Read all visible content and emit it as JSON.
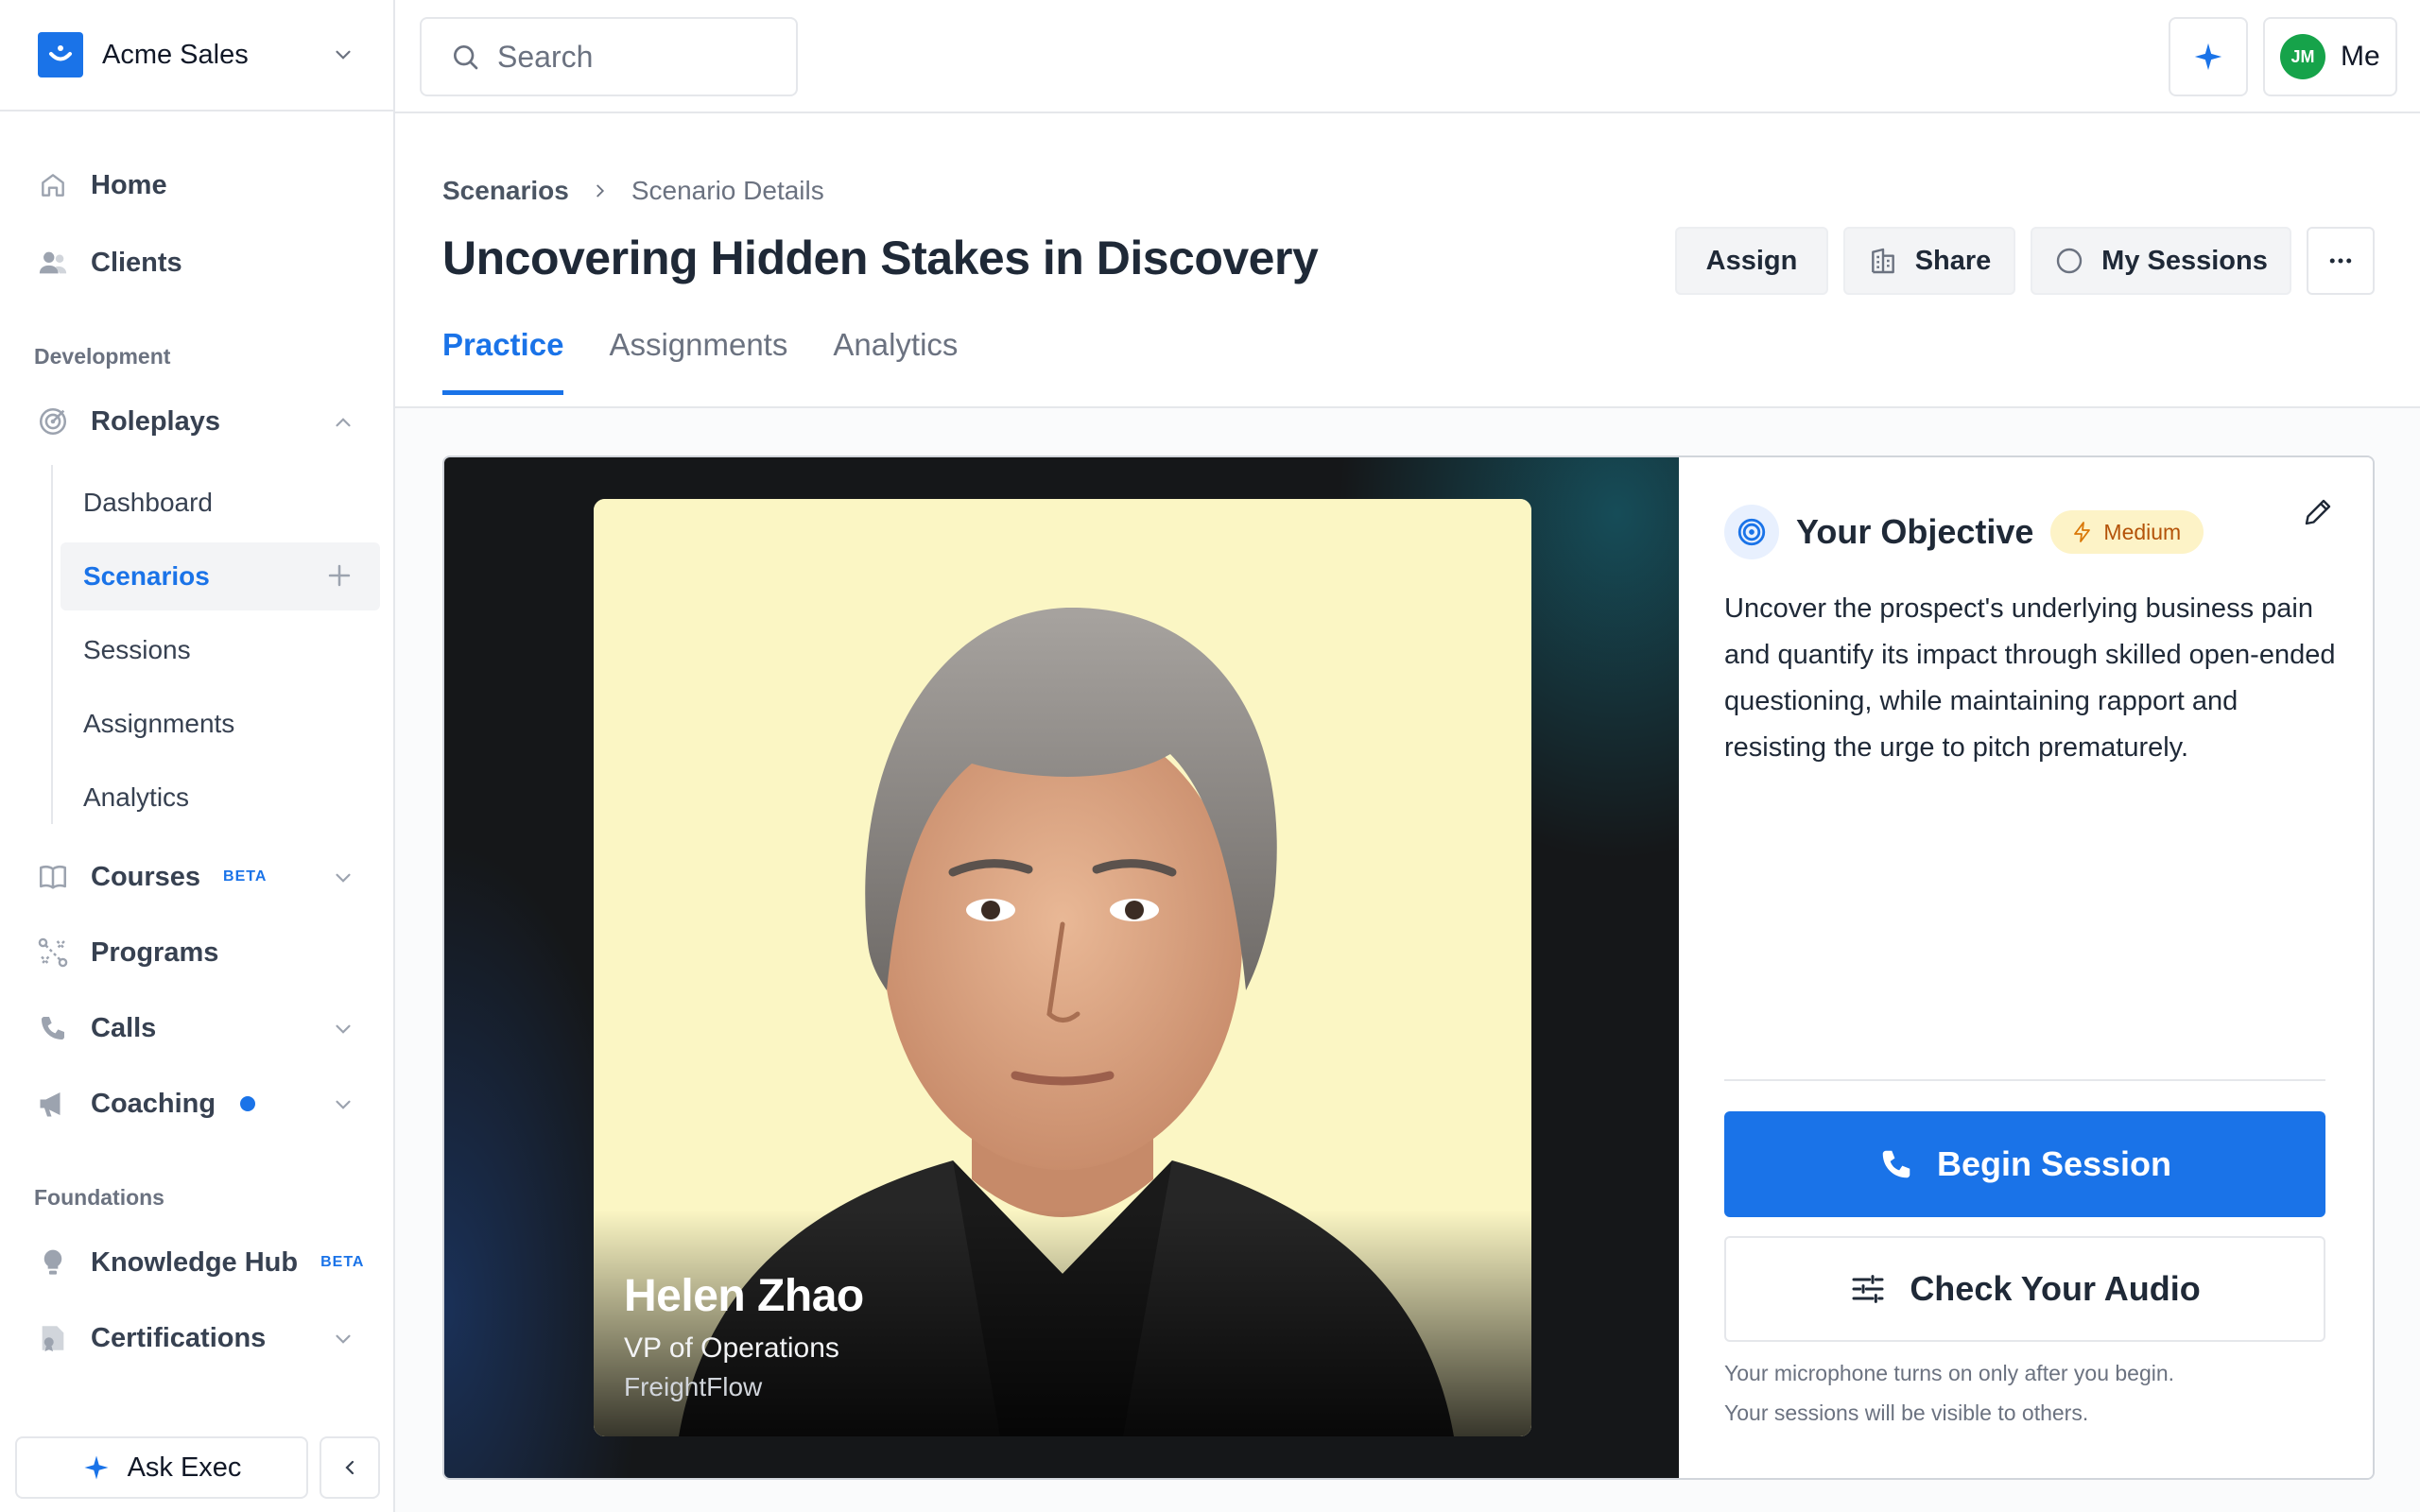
{
  "org": {
    "name": "Acme Sales"
  },
  "search": {
    "placeholder": "Search"
  },
  "user": {
    "initials": "JM",
    "label": "Me"
  },
  "sidebar": {
    "home": "Home",
    "clients": "Clients",
    "development_label": "Development",
    "roleplays": "Roleplays",
    "roleplay_items": [
      "Dashboard",
      "Scenarios",
      "Sessions",
      "Assignments",
      "Analytics"
    ],
    "courses": "Courses",
    "courses_badge": "BETA",
    "programs": "Programs",
    "calls": "Calls",
    "coaching": "Coaching",
    "foundations_label": "Foundations",
    "knowledge_hub": "Knowledge Hub",
    "knowledge_badge": "BETA",
    "certifications": "Certifications",
    "ask_exec": "Ask Exec"
  },
  "breadcrumb": {
    "parent": "Scenarios",
    "current": "Scenario Details"
  },
  "page": {
    "title": "Uncovering Hidden Stakes in Discovery"
  },
  "actions": {
    "assign": "Assign",
    "share": "Share",
    "my_sessions": "My Sessions"
  },
  "tabs": [
    "Practice",
    "Assignments",
    "Analytics"
  ],
  "persona": {
    "name": "Helen Zhao",
    "role": "VP of Operations",
    "company": "FreightFlow"
  },
  "objective": {
    "title": "Your Objective",
    "difficulty": "Medium",
    "text": "Uncover the prospect's underlying business pain and quantify its impact through skilled open-ended questioning, while maintaining rapport and resisting the urge to pitch prematurely."
  },
  "session": {
    "begin": "Begin Session",
    "check_audio": "Check Your Audio",
    "note_mic": "Your microphone turns on only after you begin.",
    "note_visibility": "Your sessions will be visible to others."
  },
  "colors": {
    "accent": "#1a73e8",
    "difficulty_bg": "#fdf3c7",
    "difficulty_text": "#b45309",
    "avatar": "#16a34a"
  }
}
